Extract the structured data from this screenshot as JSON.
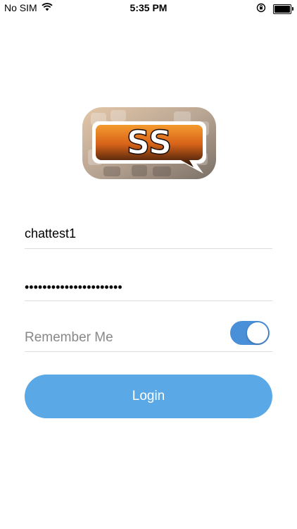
{
  "status_bar": {
    "carrier": "No SIM",
    "time": "5:35 PM"
  },
  "logo": {
    "text": "SS"
  },
  "form": {
    "username_value": "chattest1",
    "password_value": "••••••••••••••••••••••",
    "remember_label": "Remember Me",
    "remember_on": true,
    "login_label": "Login"
  },
  "colors": {
    "accent": "#5aa9e6",
    "toggle": "#4a90d9",
    "logo_orange": "#e8781a"
  },
  "icons": [
    "wifi-icon",
    "orientation-lock-icon",
    "battery-icon"
  ]
}
